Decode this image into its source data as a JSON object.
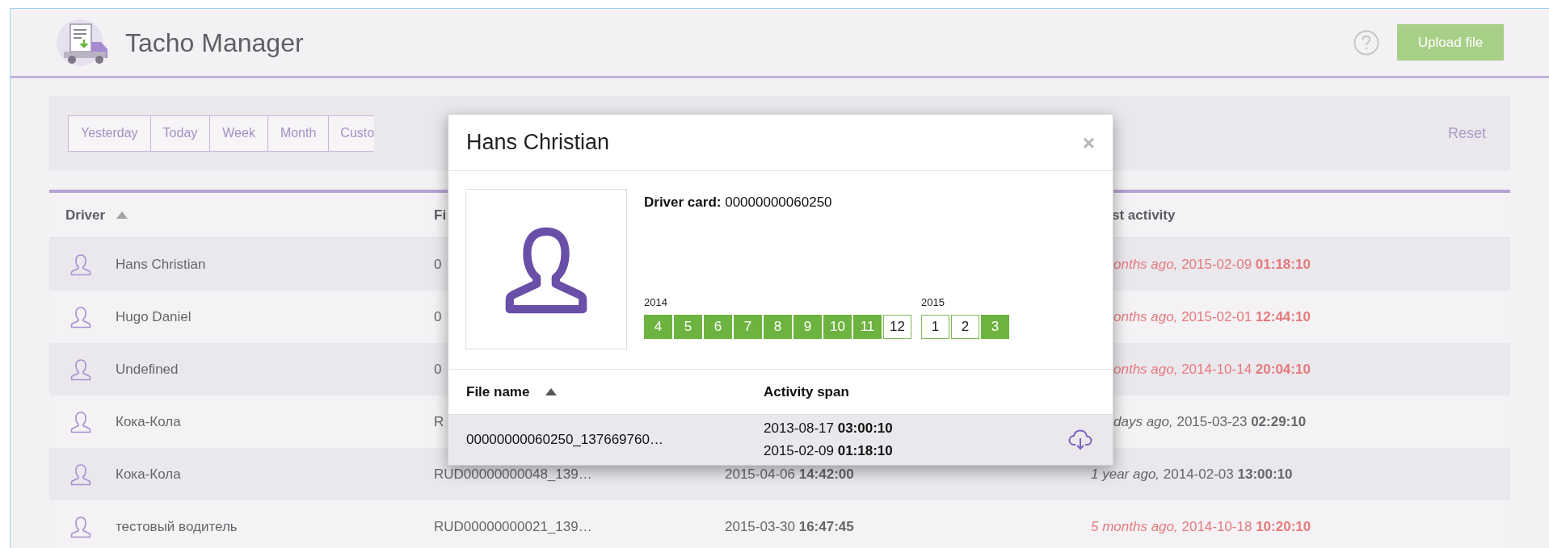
{
  "header": {
    "title": "Tacho Manager",
    "upload_button": "Upload file"
  },
  "filter": {
    "tabs": [
      {
        "label": "Yesterday"
      },
      {
        "label": "Today"
      },
      {
        "label": "Week"
      },
      {
        "label": "Month"
      },
      {
        "label": "Custo",
        "cut": true
      }
    ],
    "reset": "Reset"
  },
  "table": {
    "columns": [
      {
        "kind": "driver",
        "label": "Driver",
        "sorted": true
      },
      {
        "kind": "file",
        "label": "Fi",
        "sorted": false
      },
      {
        "kind": "activity",
        "label": "st activity",
        "sorted": false,
        "cut": true
      }
    ],
    "rows": [
      {
        "driver": "Hans Christian",
        "file": "0",
        "last_activity": {
          "ago": "onths ago,",
          "date": "2015-02-09",
          "time": "01:18:10",
          "overdue": true,
          "cut": true
        }
      },
      {
        "driver": "Hugo Daniel",
        "file": "0",
        "last_activity": {
          "ago": "onths ago,",
          "date": "2015-02-01",
          "time": "12:44:10",
          "overdue": true,
          "cut": true
        }
      },
      {
        "driver": "Undefined",
        "file": "0",
        "last_activity": {
          "ago": "onths ago,",
          "date": "2014-10-14",
          "time": "20:04:10",
          "overdue": true,
          "cut": true
        }
      },
      {
        "driver": "Кока-Кола",
        "file": "R",
        "last_activity": {
          "ago": "days ago,",
          "date": "2015-03-23",
          "time": "02:29:10",
          "overdue": false,
          "cut": true
        }
      },
      {
        "driver": "Кока-Кола",
        "file": "RUD00000000048_139…",
        "date": {
          "date": "2015-04-06",
          "time": "14:42:00"
        },
        "last_activity": {
          "ago": "1 year ago,",
          "date": "2014-02-03",
          "time": "13:00:10",
          "overdue": false,
          "cut": false
        }
      },
      {
        "driver": "тестовый водитель",
        "file": "RUD00000000021_139…",
        "date": {
          "date": "2015-03-30",
          "time": "16:47:45"
        },
        "last_activity": {
          "ago": "5 months ago,",
          "date": "2014-10-18",
          "time": "10:20:10",
          "overdue": true,
          "cut": false
        }
      }
    ]
  },
  "dialog": {
    "title": "Hans Christian",
    "close": "×",
    "card_label": "Driver card:",
    "card_number": "00000000060250",
    "years": [
      {
        "year": "2014",
        "months": [
          {
            "label": "4",
            "active": true
          },
          {
            "label": "5",
            "active": true
          },
          {
            "label": "6",
            "active": true
          },
          {
            "label": "7",
            "active": true
          },
          {
            "label": "8",
            "active": true
          },
          {
            "label": "9",
            "active": true
          },
          {
            "label": "10",
            "active": true
          },
          {
            "label": "11",
            "active": true
          },
          {
            "label": "12",
            "active": false
          }
        ]
      },
      {
        "year": "2015",
        "months": [
          {
            "label": "1",
            "active": false
          },
          {
            "label": "2",
            "active": false
          },
          {
            "label": "3",
            "active": true
          }
        ]
      }
    ],
    "columns": [
      {
        "label": "File name",
        "sorted": true
      },
      {
        "label": "Activity span",
        "sorted": false
      }
    ],
    "files": [
      {
        "name": "00000000060250_137669760…",
        "start_date": "2013-08-17",
        "start_time": "03:00:10",
        "end_date": "2015-02-09",
        "end_time": "01:18:10"
      }
    ]
  }
}
